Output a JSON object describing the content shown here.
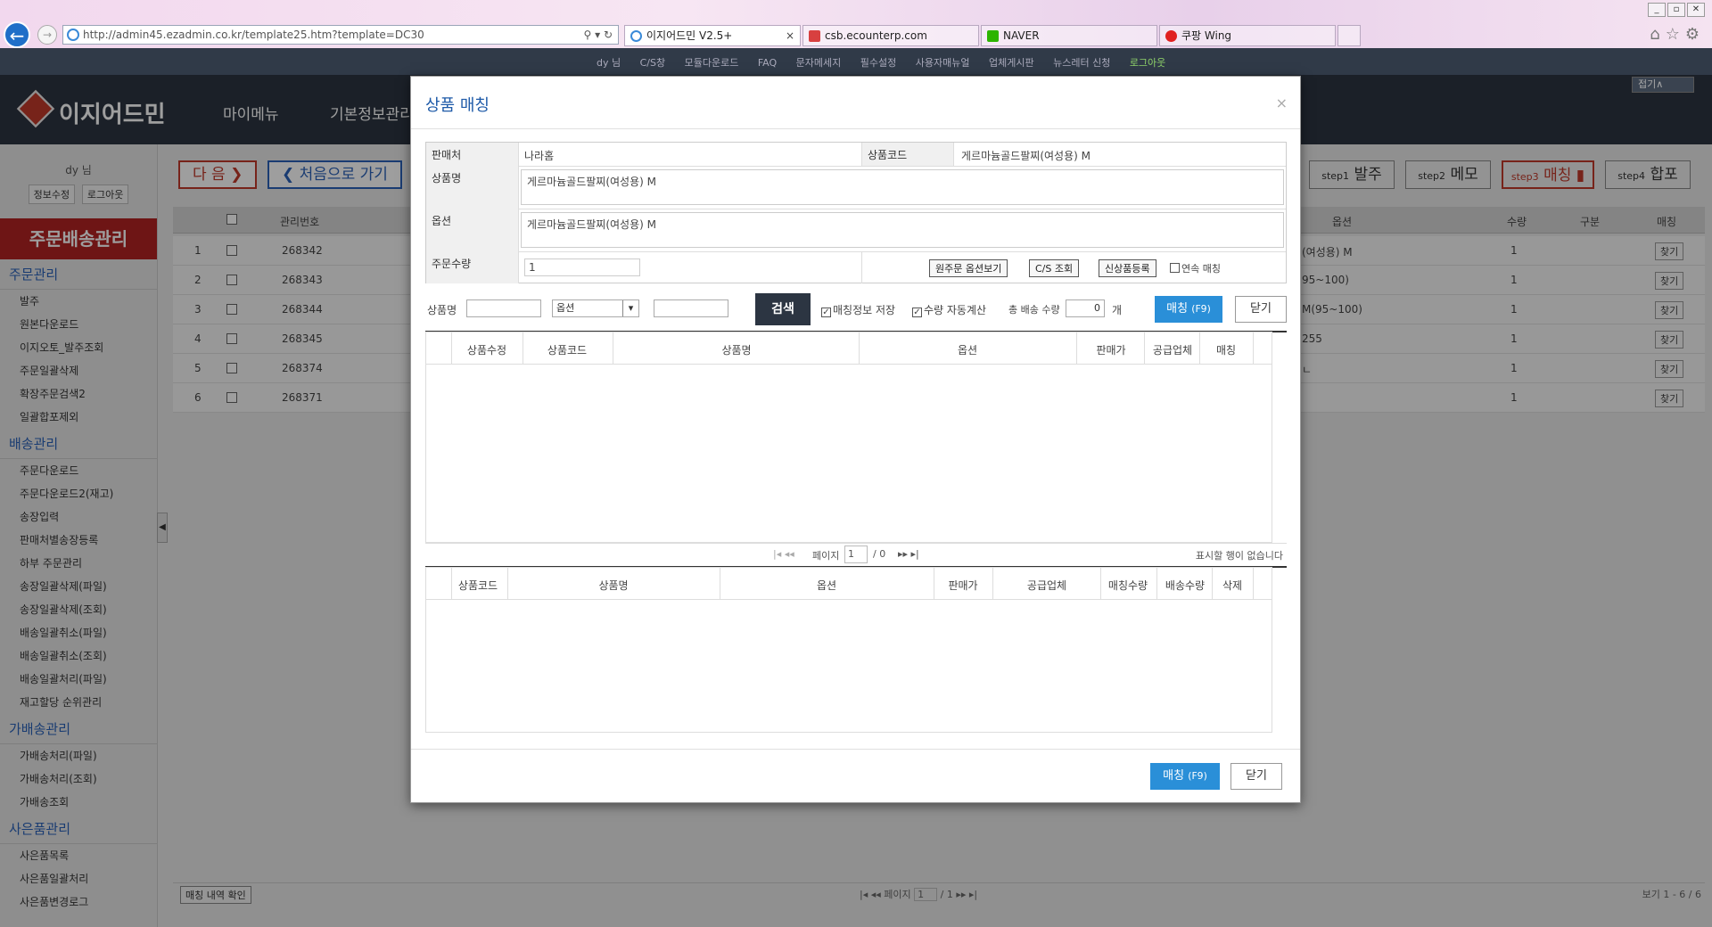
{
  "browser": {
    "url": "http://admin45.ezadmin.co.kr/template25.htm?template=DC30",
    "tabs": [
      {
        "label": "이지어드민 V2.5+",
        "active": true,
        "close": "×"
      },
      {
        "label": "csb.ecounterp.com"
      },
      {
        "label": "NAVER"
      },
      {
        "label": "쿠팡 Wing"
      }
    ]
  },
  "toplinks": {
    "items": [
      "dy 님",
      "C/S창",
      "모듈다운로드",
      "FAQ",
      "문자메세지",
      "필수설정",
      "사용자매뉴얼",
      "업체게시판",
      "뉴스레터 신청",
      "로그아웃"
    ],
    "collapse": "접기∧"
  },
  "header": {
    "logo": "이지어드민",
    "nav": [
      "마이메뉴",
      "기본정보관리"
    ]
  },
  "sidebar": {
    "user": "dy 님",
    "btn_edit": "정보수정",
    "btn_logout": "로그아웃",
    "title": "주문배송관리",
    "sections": [
      {
        "title": "주문관리",
        "items": [
          "발주",
          "원본다운로드",
          "이지오토_발주조회",
          "주문일괄삭제",
          "확장주문검색2",
          "일괄합포제외"
        ]
      },
      {
        "title": "배송관리",
        "items": [
          "주문다운로드",
          "주문다운로드2(재고)",
          "송장입력",
          "판매처별송장등록",
          "하부 주문관리",
          "송장일괄삭제(파일)",
          "송장일괄삭제(조회)",
          "배송일괄취소(파일)",
          "배송일괄취소(조회)",
          "배송일괄처리(파일)",
          "재고할당 순위관리"
        ]
      },
      {
        "title": "가배송관리",
        "items": [
          "가배송처리(파일)",
          "가배송처리(조회)",
          "가배송조회"
        ]
      },
      {
        "title": "사은품관리",
        "items": [
          "사은품목록",
          "사은품일괄처리",
          "사은품변경로그"
        ]
      }
    ]
  },
  "main": {
    "btn_next": "다 음",
    "btn_first": "처음으로 가기",
    "steps": [
      {
        "prefix": "step1",
        "label": "발주"
      },
      {
        "prefix": "step2",
        "label": "메모"
      },
      {
        "prefix": "step3",
        "label": "매칭"
      },
      {
        "prefix": "step4",
        "label": "합포"
      }
    ],
    "columns": {
      "manage_no": "관리번호",
      "option": "옵션",
      "qty": "수량",
      "type": "구분",
      "match": "매칭"
    },
    "rows": [
      {
        "no": "1",
        "manage_no": "268342",
        "option": "(여성용) M",
        "qty": "1",
        "find": "찾기"
      },
      {
        "no": "2",
        "manage_no": "268343",
        "option": "95~100)",
        "qty": "1",
        "find": "찾기"
      },
      {
        "no": "3",
        "manage_no": "268344",
        "option": "M(95~100)",
        "qty": "1",
        "find": "찾기"
      },
      {
        "no": "4",
        "manage_no": "268345",
        "option": "255",
        "qty": "1",
        "find": "찾기"
      },
      {
        "no": "5",
        "manage_no": "268374",
        "option": "ㄴ",
        "qty": "1",
        "find": "찾기"
      },
      {
        "no": "6",
        "manage_no": "268371",
        "option": "",
        "qty": "1",
        "find": "찾기"
      }
    ],
    "confirm_btn": "매칭 내역 확인",
    "pager": {
      "label": "페이지",
      "page": "1",
      "total": "/ 1"
    },
    "count": "보기 1 - 6 / 6"
  },
  "modal": {
    "title": "상품 매칭",
    "close": "×",
    "seller_label": "판매처",
    "seller_value": "나라홈",
    "code_label": "상품코드",
    "code_value": "게르마늄골드팔찌(여성용) M",
    "name_label": "상품명",
    "name_value": "게르마늄골드팔찌(여성용) M",
    "option_label": "옵션",
    "option_value": "게르마늄골드팔찌(여성용) M",
    "qty_label": "주문수량",
    "qty_value": "1",
    "btn_orig_option": "원주문 옵션보기",
    "btn_cs": "C/S 조회",
    "btn_new_product": "신상품등록",
    "chk_continuous": "연속 매칭",
    "search": {
      "name_label": "상품명",
      "select_value": "옵션",
      "btn": "검색",
      "chk_save": "매칭정보 저장",
      "chk_auto": "수량 자동계산",
      "total_label": "총 배송 수량",
      "total_value": "0",
      "unit": "개",
      "btn_match": "매칭",
      "btn_match_key": "(F9)",
      "btn_close": "닫기"
    },
    "table1_cols": [
      "상품수정",
      "상품코드",
      "상품명",
      "옵션",
      "판매가",
      "공급업체",
      "매칭"
    ],
    "pager": {
      "label": "페이지",
      "page": "1",
      "total": "/ 0",
      "empty": "표시할 행이 없습니다"
    },
    "table2_cols": [
      "상품코드",
      "상품명",
      "옵션",
      "판매가",
      "공급업체",
      "매칭수량",
      "배송수량",
      "삭제"
    ],
    "footer_match": "매칭",
    "footer_match_key": "(F9)",
    "footer_close": "닫기"
  }
}
